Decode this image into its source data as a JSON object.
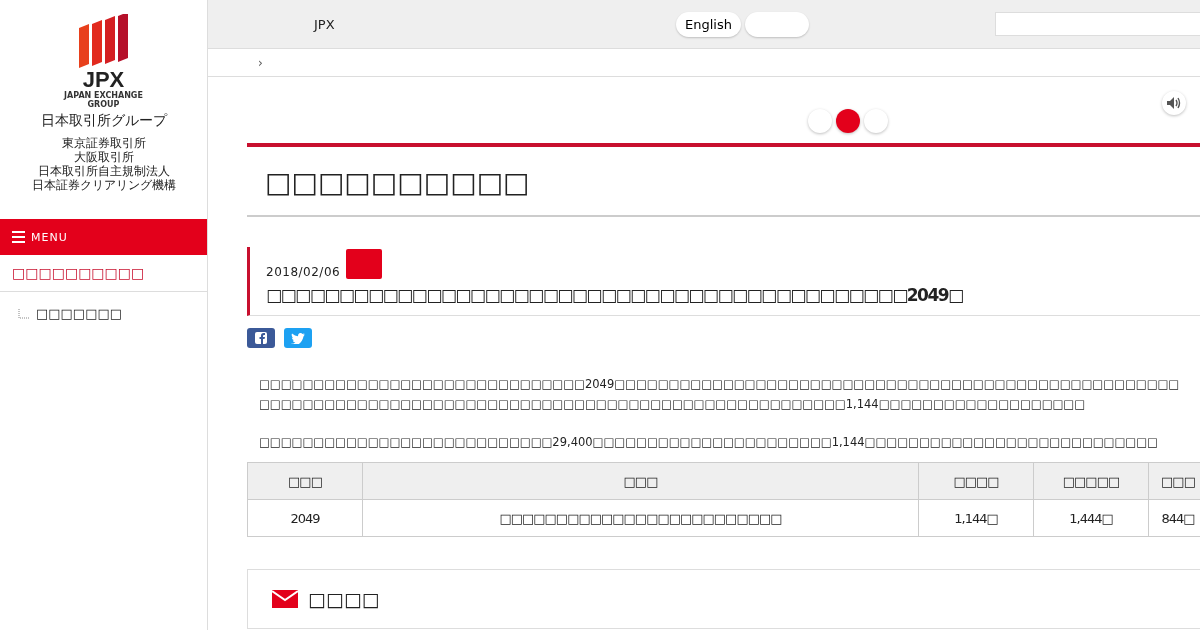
{
  "sidebar": {
    "logo_text": "JPX",
    "logo_subtext": [
      "JAPAN EXCHANGE",
      "GROUP"
    ],
    "group_name": "日本取引所グループ",
    "companies": [
      "東京証券取引所",
      "大阪取引所",
      "日本取引所自主規制法人",
      "日本証券クリアリング機構"
    ],
    "menu_label": "MENU",
    "section_link": "□□□□□□□□□□",
    "items": [
      {
        "label": "□□□□□□□"
      }
    ]
  },
  "header": {
    "site_label": "JPX",
    "language_buttons": [
      {
        "kind": "text",
        "label": "English"
      },
      {
        "kind": "blank"
      }
    ]
  },
  "breadcrumb": "›",
  "font_sizes": [
    {
      "selected": false
    },
    {
      "selected": true
    },
    {
      "selected": false
    }
  ],
  "page_title": "□□□□□□□□□□",
  "article": {
    "date": "2018/02/06",
    "headline": "□□□□□□□□□□□□□□□□□□□□□□□□□□□□□□□□□□□□□□□□□□□□**2049**□",
    "paragraphs": [
      [
        "□□□□□□□□□□□□□□□□□□□□□□□□□□□□□□2049□□□□□□□□□□□□□□□□□□□□□□□□□□□□□□□□□□□□□□□□□□□□□□□□□□□□",
        "□□□□□□□□□□□□□□□□□□□□□□□□□□□□□□□□□□□□□□□□□□□□□□□□□□□□□□1,144□□□□□□□□□□□□□□□□□□□"
      ],
      [
        "□□□□□□□□□□□□□□□□□□□□□□□□□□□29,400□□□□□□□□□□□□□□□□□□□□□□1,144□□□□□□□□□□□□□□□□□□□□□□□□□□□"
      ]
    ]
  },
  "table": {
    "columns": [
      "□□□",
      "□□□",
      "□□□□",
      "□□□□□",
      "□□□"
    ],
    "rows": [
      [
        "2049",
        "□□□□□□□□□□□□□□□□□□□□□□□□□",
        "1,144□",
        "1,444□",
        "844□"
      ]
    ]
  },
  "contact": {
    "title": "□□□□"
  }
}
